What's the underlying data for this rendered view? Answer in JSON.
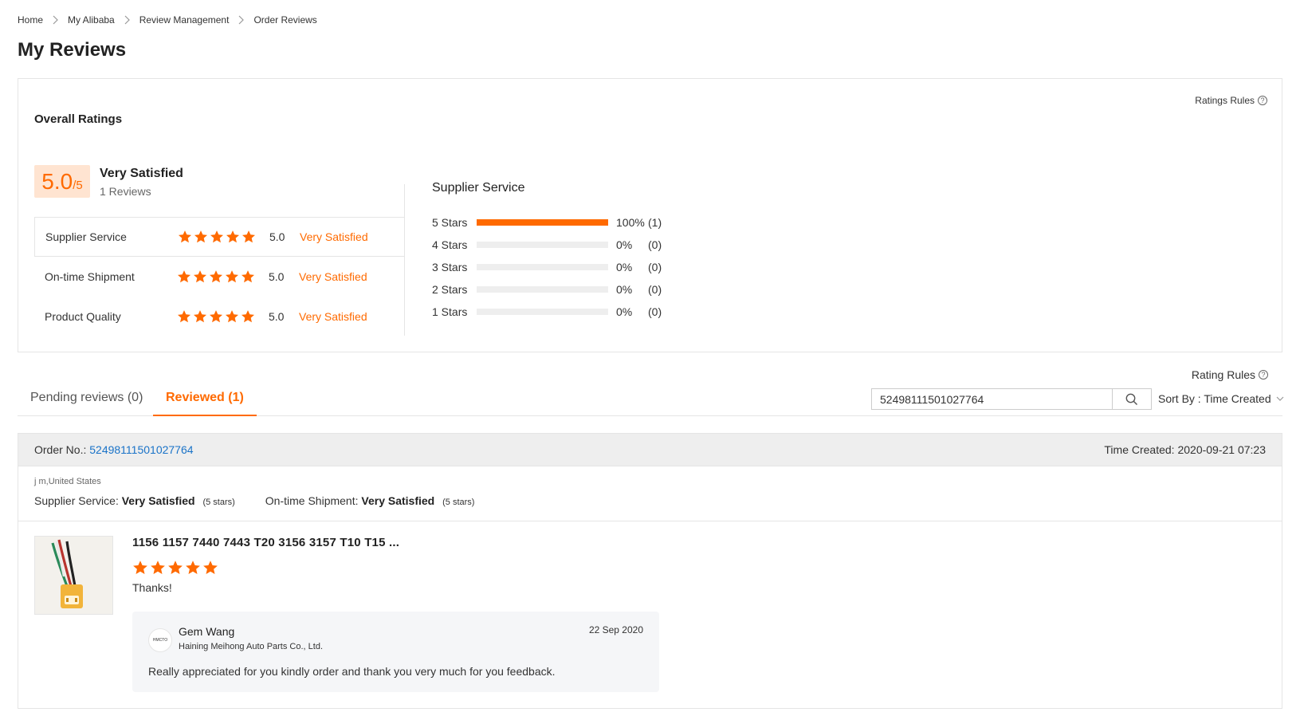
{
  "breadcrumb": {
    "items": [
      "Home",
      "My Alibaba",
      "Review Management",
      "Order Reviews"
    ]
  },
  "page_title": "My Reviews",
  "overall": {
    "title": "Overall Ratings",
    "rules_link": "Ratings Rules",
    "score": "5.0",
    "score_max": "/5",
    "satisfaction": "Very Satisfied",
    "review_count": "1 Reviews",
    "dimensions": [
      {
        "name": "Supplier Service",
        "score": "5.0",
        "label": "Very Satisfied",
        "stars": 5
      },
      {
        "name": "On-time Shipment",
        "score": "5.0",
        "label": "Very Satisfied",
        "stars": 5
      },
      {
        "name": "Product Quality",
        "score": "5.0",
        "label": "Very Satisfied",
        "stars": 5
      }
    ],
    "distribution": {
      "title": "Supplier Service",
      "rows": [
        {
          "label": "5  Stars",
          "percent": "100%",
          "count": "(1)",
          "fraction": 1.0
        },
        {
          "label": "4  Stars",
          "percent": "0%",
          "count": "(0)",
          "fraction": 0
        },
        {
          "label": "3  Stars",
          "percent": "0%",
          "count": "(0)",
          "fraction": 0
        },
        {
          "label": "2  Stars",
          "percent": "0%",
          "count": "(0)",
          "fraction": 0
        },
        {
          "label": "1  Stars",
          "percent": "0%",
          "count": "(0)",
          "fraction": 0
        }
      ]
    }
  },
  "list": {
    "rules_link": "Rating Rules",
    "tabs": [
      {
        "label": "Pending reviews (0)"
      },
      {
        "label": "Reviewed (1)"
      }
    ],
    "search_value": "52498111501027764",
    "sort_label": "Sort By : Time Created"
  },
  "order": {
    "order_no_label": "Order No.:",
    "order_no": "52498111501027764",
    "time_created": "Time Created: 2020-09-21 07:23",
    "buyer": "j m,United States",
    "supplier_service_label": "Supplier Service:",
    "supplier_service_value": "Very Satisfied",
    "supplier_service_stars": "(5 stars)",
    "shipment_label": "On-time Shipment:",
    "shipment_value": "Very Satisfied",
    "shipment_stars": "(5 stars)",
    "product_title": "1156 1157 7440 7443 T20 3156 3157 T10 T15 ...",
    "product_stars": 5,
    "review_text": "Thanks!",
    "reply": {
      "avatar_text": "HMCTO",
      "name": "Gem Wang",
      "company": "Haining Meihong Auto Parts Co., Ltd.",
      "date": "22 Sep 2020",
      "text": "Really appreciated for you kindly order and thank you very much for you feedback."
    }
  },
  "colors": {
    "accent": "#ff6a00",
    "link": "#1a73c8",
    "score_bg": "#ffe4d1"
  }
}
